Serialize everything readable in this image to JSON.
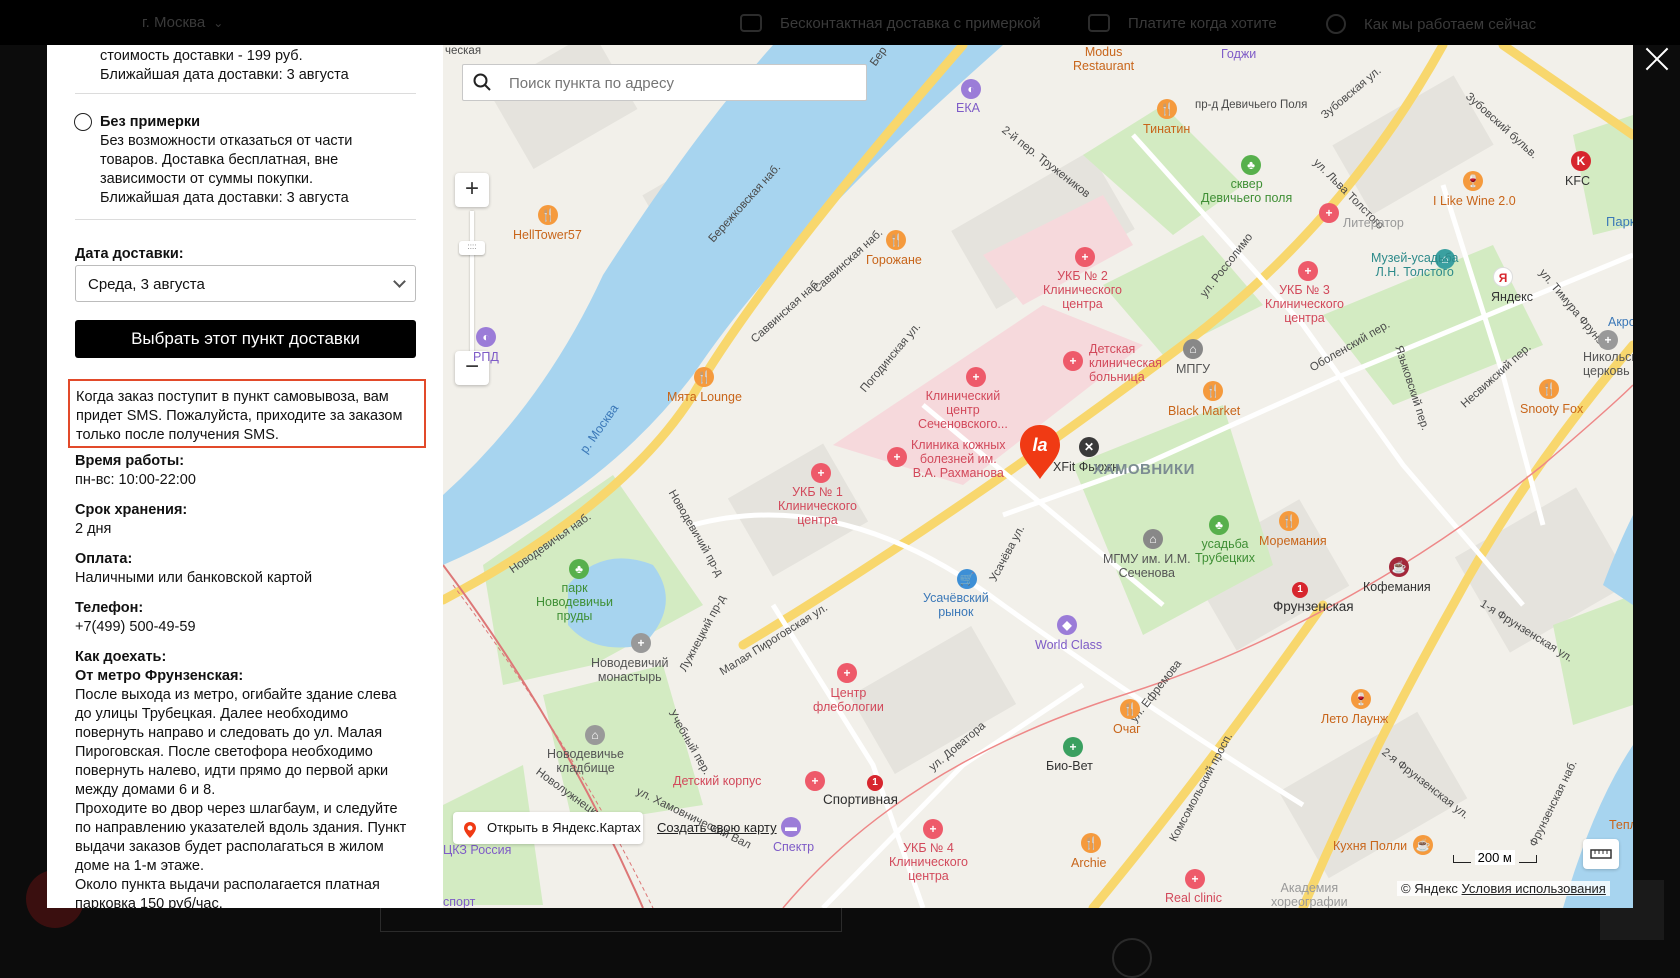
{
  "topbar": {
    "city": "г. Москва",
    "features": [
      "Бесконтактная доставка с примеркой",
      "Платите когда хотите",
      "Как мы работаем сейчас"
    ]
  },
  "left_panel": {
    "prev_option_lines": [
      "стоимость доставки - 199 руб.",
      "Ближайшая дата доставки: 3 августа"
    ],
    "option_no_fitting": {
      "title": "Без примерки",
      "lines": [
        "Без возможности отказаться от части",
        "товаров. Доставка бесплатная, вне",
        "зависимости от суммы покупки.",
        "Ближайшая дата доставки: 3 августа"
      ]
    },
    "date_label": "Дата доставки:",
    "date_value": "Среда, 3 августа",
    "select_button": "Выбрать этот пункт доставки",
    "notice_lines": [
      "Когда заказ поступит в пункт самовывоза, вам",
      "придет SMS. Пожалуйста, приходите за заказом",
      "только после получения SMS."
    ],
    "hours_label": "Время работы:",
    "hours_value": "пн-вс: 10:00-22:00",
    "storage_label": "Срок хранения:",
    "storage_value": "2 дня",
    "payment_label": "Оплата:",
    "payment_value": "Наличными или банковской картой",
    "phone_label": "Телефон:",
    "phone_value": "+7(499) 500-49-59",
    "route_label": "Как доехать:",
    "route_subtitle": "От метро Фрунзенская:",
    "route_lines": [
      "После выхода из метро, огибайте здание слева",
      "до улицы Трубецкая. Далее необходимо",
      "повернуть направо и следовать до ул. Малая",
      "Пироговская. После светофора необходимо",
      "повернуть налево, идти прямо до первой арки",
      "между домами 6 и 8.",
      "Проходите во двор через шлагбаум, и следуйте",
      "по направлению указателей вдоль здания. Пункт",
      "выдачи заказов будет располагаться в жилом",
      "доме на 1-м этаже.",
      "Около пункта выдачи располагается платная",
      "парковка 150 руб/час."
    ]
  },
  "map": {
    "search_placeholder": "Поиск пункта по адресу",
    "zoom_in": "+",
    "zoom_out": "−",
    "zoom_handle": "::::",
    "marker_label": "la",
    "district": "ХАМОВНИКИ",
    "river": "р. Москва",
    "labels": {
      "hell_tower": "HellTower57",
      "gorozhane": "Горожане",
      "myata": "Мята Lounge",
      "rpd": "РПД",
      "eka": "ЕКА",
      "modus": "Modus\nRestaurant",
      "godzhi": "Годжи",
      "tinatin": "Тинатин",
      "skver": "сквер\nДевичьего поля",
      "i_like_wine": "I Like Wine 2.0",
      "kfc": "KFC",
      "park": "Парк",
      "literator": "Литератор",
      "tolstoy": "Музей-усадьба\nЛ.Н. Толстого",
      "yandex": "Яндекс",
      "akro": "Акро",
      "ukb2": "УКБ № 2\nКлинического\nцентра",
      "ukb3": "УКБ № 3\nКлинического\nцентра",
      "mpgu": "МПГУ",
      "nikolsk": "Никольск\nцерковь",
      "kids_hospital": "Детская\nклиническая\nбольница",
      "black_market": "Black Market",
      "snooty_fox": "Snooty Fox",
      "sechenov_center": "Клинический\nцентр\nСеченовского...",
      "xfit": "XFit Фьюжн",
      "skin_clinic": "Клиника кожных\nболезней им.\nВ.А. Рахманова",
      "ukb1": "УКБ № 1\nКлинического\nцентра",
      "trubetskikh": "усадьба\nТрубецких",
      "moremania": "Моремания",
      "mgmu": "МГМУ им. И.М.\nСеченова",
      "frunzenskaya": "Фрунзенская",
      "kofemania": "Кофемания",
      "novodevichy_park": "парк\nНоводевичьи\nпруды",
      "usachevsky": "Усачёвский\nрынок",
      "world_class": "World Class",
      "novodevichy_monastery": "Новодевичий\nмонастырь",
      "flebology": "Центр\nфлебологии",
      "leto": "Лето Лаунж",
      "ochag": "Очаг",
      "novodevichy_cemetery": "Новодевичье\nкладбище",
      "bio_vet": "Био-Вет",
      "kids_building": "Детский корпус",
      "sportivnaya": "Спортивная",
      "ukb4": "УКБ № 4\nКлинического\nцентра",
      "spektr": "Спектр",
      "kukhnya": "Кухня Полли",
      "archie": "Archie",
      "real_clinic": "Real clinic",
      "academy": "Академия\nхореографии",
      "cz_russia": "ЦКЗ Россия",
      "sport": "спорт",
      "tepl": "Тепл"
    },
    "streets": {
      "berezhkovskaya": "Бережковская наб.",
      "savvinskaya1": "Саввинская наб.",
      "savvinskaya2": "Саввинская наб.",
      "pogodinskaya": "Погодинская ул.",
      "truzhenikov": "2-й пер. Тружеников",
      "devichy": "пр-д Девичьего Поля",
      "zubovsky": "Зубовский бульв.",
      "zubovskaya": "Зубовская ул.",
      "tolstogo": "ул. Льва Толстого",
      "timura": "ул. Тимура Фрунзе",
      "rossolimo": "ул. Россолимо",
      "obolensky": "Оболенский пер.",
      "yaroslavsky": "Языковский пер.",
      "nesvizhsky": "Несвижский пер.",
      "novodevichya_nab": "Новодевичья наб.",
      "novodevichy_prd": "Новодевичий пр-д",
      "luzhnetsky": "Лужнецкий пр-д",
      "malaya_pirog": "Малая Пироговская ул.",
      "usacheva": "Усачёва ул.",
      "efremova": "ул. Ефремова",
      "komsomolsky": "Комсомольский просп.",
      "frunzenskaya1": "1-я Фрунзенская ул.",
      "frunzenskaya2": "2-я Фрунзенская ул.",
      "frunz_nab": "Фрунзенская наб.",
      "uchebny": "Учебный пер.",
      "doroshenko": "ул. Доватора",
      "khamovnichesky": "ул. Хамовнический Вал",
      "novoluzhnetsky": "Новолужнецкий пр-д",
      "naberezhnaya_top": "ческая",
      "bereg": "Бер"
    },
    "metro_badge": "1",
    "open_yandex": "Открыть в Яндекс.Картах",
    "create_map": "Создать свою карту",
    "copyright": "© Яндекс",
    "terms": "Условия использования",
    "scale": "200 м",
    "colors": {
      "water": "#a7d4ef",
      "park": "#d4ecc4",
      "road_major": "#f7d56a",
      "hospital_red": "#ee5a6a",
      "food_orange": "#f59a3d",
      "metro_red": "#d7262e",
      "marker": "#f03a14"
    }
  }
}
